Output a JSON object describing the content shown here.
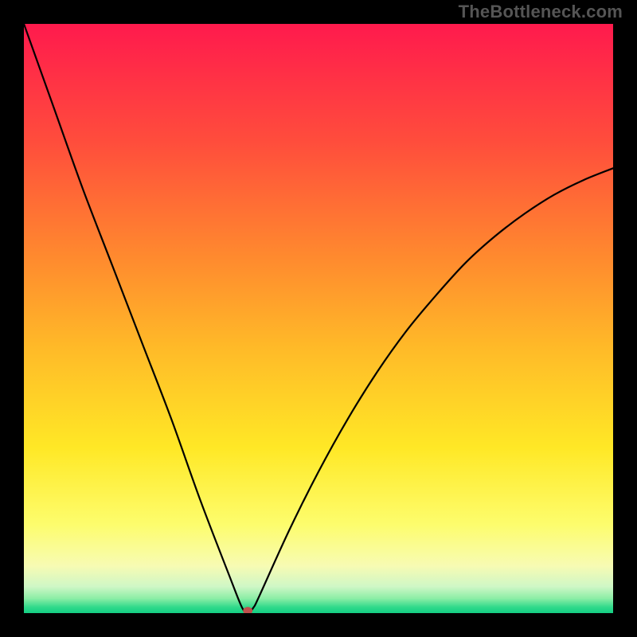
{
  "watermark": "TheBottleneck.com",
  "chart_data": {
    "type": "line",
    "title": "",
    "xlabel": "",
    "ylabel": "",
    "xlim": [
      0,
      100
    ],
    "ylim": [
      0,
      100
    ],
    "grid": false,
    "legend": null,
    "series": [
      {
        "name": "bottleneck-curve",
        "x": [
          0,
          5,
          10,
          15,
          20,
          25,
          30,
          35,
          37,
          38,
          39,
          40,
          45,
          50,
          55,
          60,
          65,
          70,
          75,
          80,
          85,
          90,
          95,
          100
        ],
        "y": [
          100,
          86,
          72,
          59,
          46,
          33,
          19,
          6,
          1,
          0,
          1,
          3,
          14,
          24,
          33,
          41,
          48,
          54,
          59.5,
          64,
          67.8,
          71,
          73.5,
          75.5
        ]
      }
    ],
    "marker": {
      "x": 38,
      "y": 0,
      "color": "#c0504d"
    },
    "gradient_stops": [
      {
        "offset": 0.0,
        "color": "#ff1a4d"
      },
      {
        "offset": 0.2,
        "color": "#ff4d3c"
      },
      {
        "offset": 0.4,
        "color": "#ff8b2e"
      },
      {
        "offset": 0.55,
        "color": "#ffba28"
      },
      {
        "offset": 0.72,
        "color": "#ffe826"
      },
      {
        "offset": 0.85,
        "color": "#fdfd6d"
      },
      {
        "offset": 0.92,
        "color": "#f7fbb3"
      },
      {
        "offset": 0.955,
        "color": "#cff7c6"
      },
      {
        "offset": 0.975,
        "color": "#8ceea6"
      },
      {
        "offset": 0.99,
        "color": "#30d98b"
      },
      {
        "offset": 1.0,
        "color": "#14cf84"
      }
    ]
  }
}
